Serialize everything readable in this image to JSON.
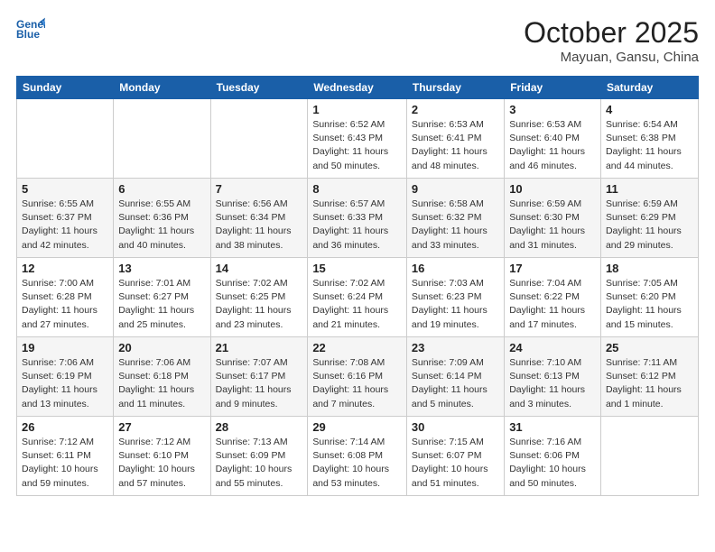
{
  "logo": {
    "line1": "General",
    "line2": "Blue"
  },
  "header": {
    "month": "October 2025",
    "location": "Mayuan, Gansu, China"
  },
  "weekdays": [
    "Sunday",
    "Monday",
    "Tuesday",
    "Wednesday",
    "Thursday",
    "Friday",
    "Saturday"
  ],
  "weeks": [
    [
      {
        "day": "",
        "info": ""
      },
      {
        "day": "",
        "info": ""
      },
      {
        "day": "",
        "info": ""
      },
      {
        "day": "1",
        "info": "Sunrise: 6:52 AM\nSunset: 6:43 PM\nDaylight: 11 hours\nand 50 minutes."
      },
      {
        "day": "2",
        "info": "Sunrise: 6:53 AM\nSunset: 6:41 PM\nDaylight: 11 hours\nand 48 minutes."
      },
      {
        "day": "3",
        "info": "Sunrise: 6:53 AM\nSunset: 6:40 PM\nDaylight: 11 hours\nand 46 minutes."
      },
      {
        "day": "4",
        "info": "Sunrise: 6:54 AM\nSunset: 6:38 PM\nDaylight: 11 hours\nand 44 minutes."
      }
    ],
    [
      {
        "day": "5",
        "info": "Sunrise: 6:55 AM\nSunset: 6:37 PM\nDaylight: 11 hours\nand 42 minutes."
      },
      {
        "day": "6",
        "info": "Sunrise: 6:55 AM\nSunset: 6:36 PM\nDaylight: 11 hours\nand 40 minutes."
      },
      {
        "day": "7",
        "info": "Sunrise: 6:56 AM\nSunset: 6:34 PM\nDaylight: 11 hours\nand 38 minutes."
      },
      {
        "day": "8",
        "info": "Sunrise: 6:57 AM\nSunset: 6:33 PM\nDaylight: 11 hours\nand 36 minutes."
      },
      {
        "day": "9",
        "info": "Sunrise: 6:58 AM\nSunset: 6:32 PM\nDaylight: 11 hours\nand 33 minutes."
      },
      {
        "day": "10",
        "info": "Sunrise: 6:59 AM\nSunset: 6:30 PM\nDaylight: 11 hours\nand 31 minutes."
      },
      {
        "day": "11",
        "info": "Sunrise: 6:59 AM\nSunset: 6:29 PM\nDaylight: 11 hours\nand 29 minutes."
      }
    ],
    [
      {
        "day": "12",
        "info": "Sunrise: 7:00 AM\nSunset: 6:28 PM\nDaylight: 11 hours\nand 27 minutes."
      },
      {
        "day": "13",
        "info": "Sunrise: 7:01 AM\nSunset: 6:27 PM\nDaylight: 11 hours\nand 25 minutes."
      },
      {
        "day": "14",
        "info": "Sunrise: 7:02 AM\nSunset: 6:25 PM\nDaylight: 11 hours\nand 23 minutes."
      },
      {
        "day": "15",
        "info": "Sunrise: 7:02 AM\nSunset: 6:24 PM\nDaylight: 11 hours\nand 21 minutes."
      },
      {
        "day": "16",
        "info": "Sunrise: 7:03 AM\nSunset: 6:23 PM\nDaylight: 11 hours\nand 19 minutes."
      },
      {
        "day": "17",
        "info": "Sunrise: 7:04 AM\nSunset: 6:22 PM\nDaylight: 11 hours\nand 17 minutes."
      },
      {
        "day": "18",
        "info": "Sunrise: 7:05 AM\nSunset: 6:20 PM\nDaylight: 11 hours\nand 15 minutes."
      }
    ],
    [
      {
        "day": "19",
        "info": "Sunrise: 7:06 AM\nSunset: 6:19 PM\nDaylight: 11 hours\nand 13 minutes."
      },
      {
        "day": "20",
        "info": "Sunrise: 7:06 AM\nSunset: 6:18 PM\nDaylight: 11 hours\nand 11 minutes."
      },
      {
        "day": "21",
        "info": "Sunrise: 7:07 AM\nSunset: 6:17 PM\nDaylight: 11 hours\nand 9 minutes."
      },
      {
        "day": "22",
        "info": "Sunrise: 7:08 AM\nSunset: 6:16 PM\nDaylight: 11 hours\nand 7 minutes."
      },
      {
        "day": "23",
        "info": "Sunrise: 7:09 AM\nSunset: 6:14 PM\nDaylight: 11 hours\nand 5 minutes."
      },
      {
        "day": "24",
        "info": "Sunrise: 7:10 AM\nSunset: 6:13 PM\nDaylight: 11 hours\nand 3 minutes."
      },
      {
        "day": "25",
        "info": "Sunrise: 7:11 AM\nSunset: 6:12 PM\nDaylight: 11 hours\nand 1 minute."
      }
    ],
    [
      {
        "day": "26",
        "info": "Sunrise: 7:12 AM\nSunset: 6:11 PM\nDaylight: 10 hours\nand 59 minutes."
      },
      {
        "day": "27",
        "info": "Sunrise: 7:12 AM\nSunset: 6:10 PM\nDaylight: 10 hours\nand 57 minutes."
      },
      {
        "day": "28",
        "info": "Sunrise: 7:13 AM\nSunset: 6:09 PM\nDaylight: 10 hours\nand 55 minutes."
      },
      {
        "day": "29",
        "info": "Sunrise: 7:14 AM\nSunset: 6:08 PM\nDaylight: 10 hours\nand 53 minutes."
      },
      {
        "day": "30",
        "info": "Sunrise: 7:15 AM\nSunset: 6:07 PM\nDaylight: 10 hours\nand 51 minutes."
      },
      {
        "day": "31",
        "info": "Sunrise: 7:16 AM\nSunset: 6:06 PM\nDaylight: 10 hours\nand 50 minutes."
      },
      {
        "day": "",
        "info": ""
      }
    ]
  ]
}
